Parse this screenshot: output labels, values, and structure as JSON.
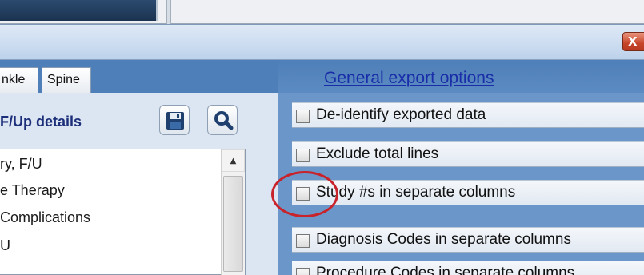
{
  "tabs": [
    {
      "label": "nkle"
    },
    {
      "label": "Spine"
    }
  ],
  "left_panel": {
    "title": "F/Up details",
    "list_items": [
      "ry, F/U",
      "e Therapy",
      "Complications",
      "U"
    ]
  },
  "window": {
    "close_label": "X"
  },
  "export_options": {
    "title": "General export options",
    "options": [
      {
        "label": "De-identify exported data",
        "checked": false
      },
      {
        "label": "Exclude total lines",
        "checked": false
      },
      {
        "label": "Study #s in separate columns",
        "checked": false
      },
      {
        "label": "Diagnosis Codes in separate columns",
        "checked": false
      },
      {
        "label": "Procedure Codes in separate columns",
        "checked": false
      }
    ]
  },
  "colors": {
    "accent_blue": "#4f7fb8",
    "link_blue": "#1a2da8",
    "highlight_red": "#c8232b"
  }
}
